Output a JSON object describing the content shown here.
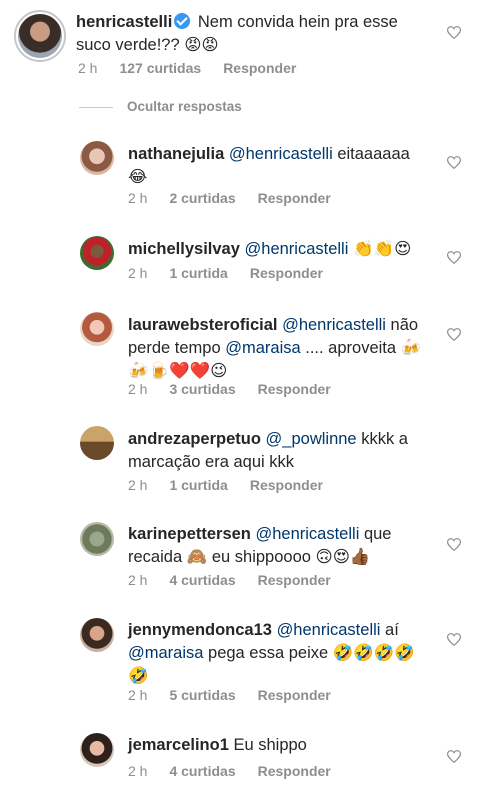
{
  "main_comment": {
    "username": "henricastelli",
    "text": "Nem convida hein pra esse suco verde!?? 😡😡",
    "time": "2 h",
    "likes": "127 curtidas",
    "reply": "Responder"
  },
  "hide_replies": "Ocultar respostas",
  "replies": [
    {
      "username": "nathanejulia",
      "mention": "@henricastelli",
      "text": " eitaaaaaa 😂",
      "time": "2 h",
      "likes": "2 curtidas",
      "reply": "Responder"
    },
    {
      "username": "michellysilvay",
      "mention": "@henricastelli",
      "text": " 👏👏😍",
      "time": "2 h",
      "likes": "1 curtida",
      "reply": "Responder"
    },
    {
      "username": "laurawebsteroficial",
      "mention": "@henricastelli",
      "text": " não perde tempo ",
      "mention2": "@maraisa",
      "text2": " .... aproveita 🍻🍻🍺❤️❤️😉",
      "time": "2 h",
      "likes": "3 curtidas",
      "reply": "Responder"
    },
    {
      "username": "andrezaperpetuo",
      "mention": "@_powlinne",
      "text": "  kkkk a marcação era aqui kkk",
      "time": "2 h",
      "likes": "1 curtida",
      "reply": "Responder"
    },
    {
      "username": "karinepettersen",
      "mention": "@henricastelli",
      "text": " que recaida 🙈 eu shippoooo 🙃😍👍🏾",
      "time": "2 h",
      "likes": "4 curtidas",
      "reply": "Responder"
    },
    {
      "username": "jennymendonca13",
      "mention": "@henricastelli",
      "text": " aí ",
      "mention2": "@maraisa",
      "text2": "  pega essa peixe 🤣🤣🤣🤣🤣",
      "time": "2 h",
      "likes": "5 curtidas",
      "reply": "Responder"
    },
    {
      "username": "jemarcelino1",
      "mention": "",
      "text": " Eu shippo",
      "time": "2 h",
      "likes": "4 curtidas",
      "reply": "Responder"
    }
  ],
  "icons": {
    "heart": "heart-outline-icon",
    "verified": "verified-badge-icon"
  },
  "colors": {
    "mention": "#00376b",
    "meta": "#8e8e8e",
    "verified": "#3897f0"
  }
}
